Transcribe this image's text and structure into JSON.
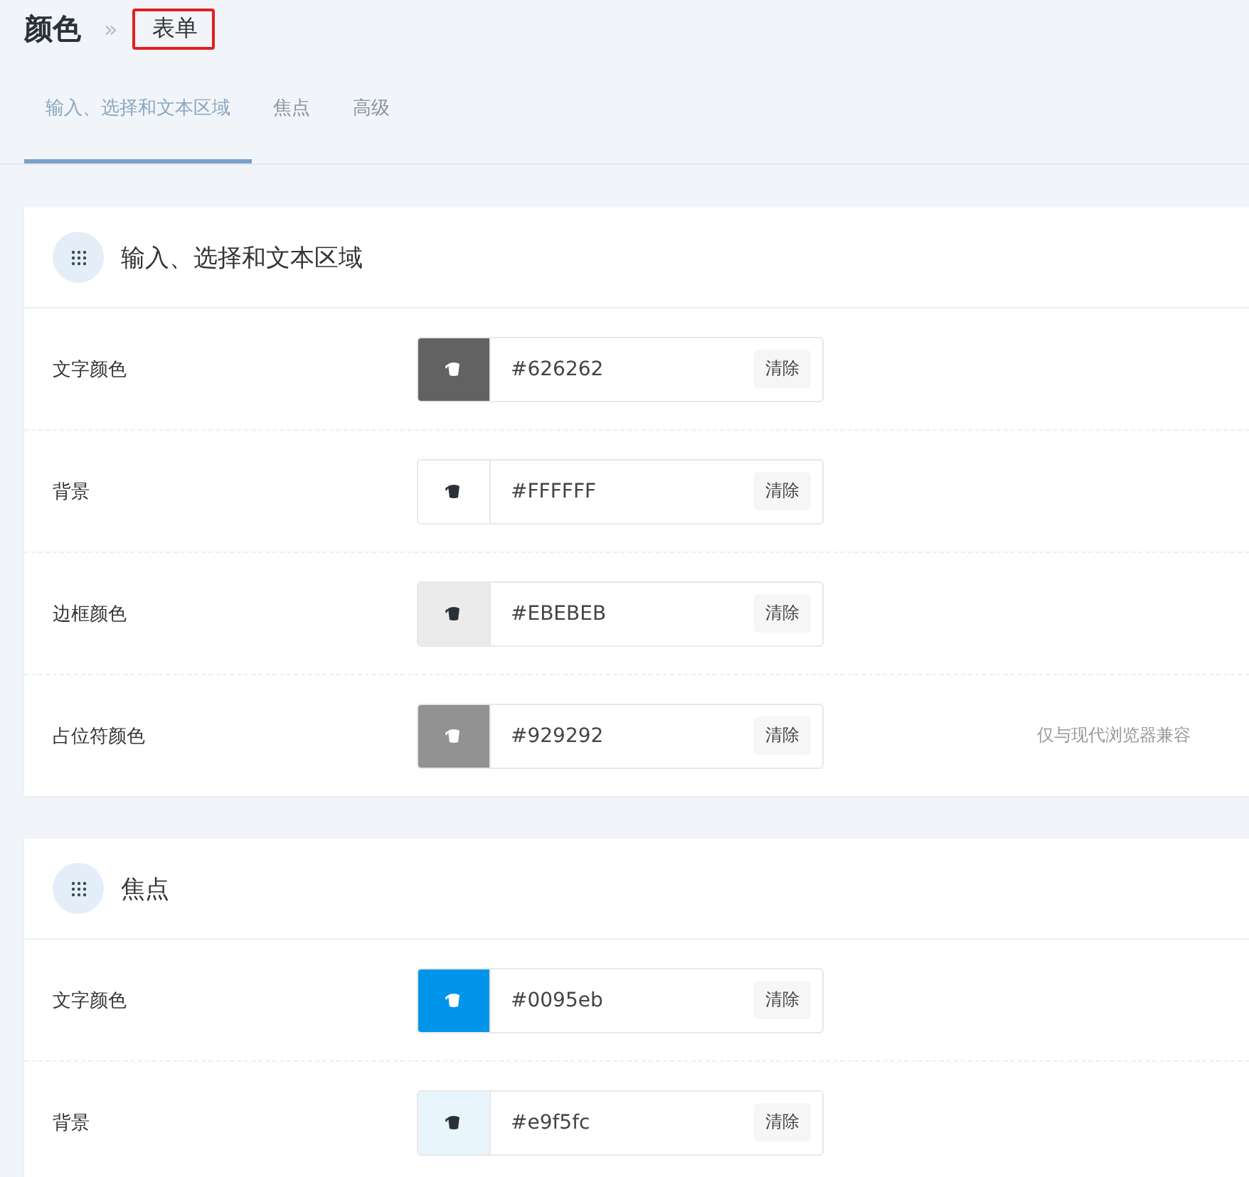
{
  "header": {
    "title": "颜色",
    "separator": "»",
    "breadcrumb": {
      "label": "表单",
      "highlighted": true
    }
  },
  "tabs": [
    {
      "label": "输入、选择和文本区域",
      "selected": true
    },
    {
      "label": "焦点",
      "selected": false
    },
    {
      "label": "高级",
      "selected": false
    }
  ],
  "sections": [
    {
      "title": "输入、选择和文本区域",
      "rows": [
        {
          "label": "文字颜色",
          "color": "#626262",
          "value": "#626262",
          "clear": "清除"
        },
        {
          "label": "背景",
          "color": "#ffffff",
          "value": "#FFFFFF",
          "clear": "清除"
        },
        {
          "label": "边框颜色",
          "color": "#ebebeb",
          "value": "#EBEBEB",
          "clear": "清除"
        },
        {
          "label": "占位符颜色",
          "color": "#929292",
          "value": "#929292",
          "clear": "清除",
          "hint": "仅与现代浏览器兼容"
        }
      ]
    },
    {
      "title": "焦点",
      "rows": [
        {
          "label": "文字颜色",
          "color": "#0095eb",
          "value": "#0095eb",
          "clear": "清除"
        },
        {
          "label": "背景",
          "color": "#e9f5fc",
          "value": "#e9f5fc",
          "clear": "清除"
        }
      ]
    }
  ]
}
